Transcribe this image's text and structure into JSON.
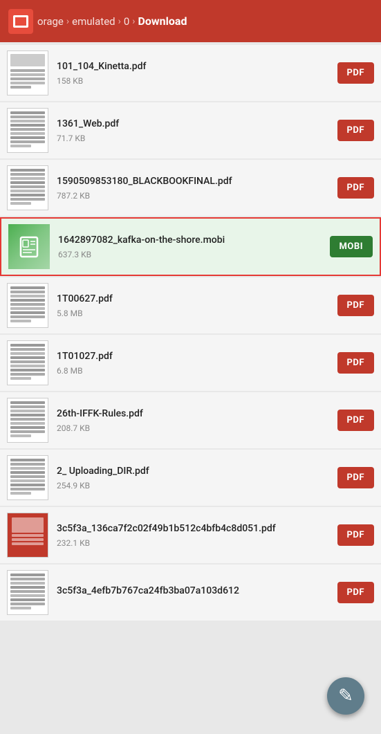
{
  "header": {
    "breadcrumbs": [
      {
        "label": "orage",
        "isCurrent": false
      },
      {
        "sep": "›"
      },
      {
        "label": "emulated",
        "isCurrent": false
      },
      {
        "sep": "›"
      },
      {
        "label": "0",
        "isCurrent": false
      },
      {
        "sep": "›"
      },
      {
        "label": "Download",
        "isCurrent": true
      }
    ],
    "logo_alt": "File Manager Logo"
  },
  "files": [
    {
      "id": 1,
      "name": "101_104_Kinetta.pdf",
      "size": "158 KB",
      "type": "PDF",
      "selected": false,
      "thumb_type": "image_pdf"
    },
    {
      "id": 2,
      "name": "1361_Web.pdf",
      "size": "71.7 KB",
      "type": "PDF",
      "selected": false,
      "thumb_type": "text_pdf"
    },
    {
      "id": 3,
      "name": "1590509853180_BLACKBOOKFINAL.pdf",
      "size": "787.2 KB",
      "type": "PDF",
      "selected": false,
      "thumb_type": "text_pdf2"
    },
    {
      "id": 4,
      "name": "1642897082_kafka-on-the-shore.mobi",
      "size": "637.3 KB",
      "type": "MOBI",
      "selected": true,
      "thumb_type": "mobi"
    },
    {
      "id": 5,
      "name": "1T00627.pdf",
      "size": "5.8 MB",
      "type": "PDF",
      "selected": false,
      "thumb_type": "text_pdf"
    },
    {
      "id": 6,
      "name": "1T01027.pdf",
      "size": "6.8 MB",
      "type": "PDF",
      "selected": false,
      "thumb_type": "text_pdf"
    },
    {
      "id": 7,
      "name": "26th-IFFK-Rules.pdf",
      "size": "208.7 KB",
      "type": "PDF",
      "selected": false,
      "thumb_type": "text_pdf3"
    },
    {
      "id": 8,
      "name": "2_ Uploading_DIR.pdf",
      "size": "254.9 KB",
      "type": "PDF",
      "selected": false,
      "thumb_type": "text_pdf"
    },
    {
      "id": 9,
      "name": "3c5f3a_136ca7f2c02f49b1b512c4bfb4c8d051.pdf",
      "size": "232.1 KB",
      "type": "PDF",
      "selected": false,
      "thumb_type": "cover_pdf"
    },
    {
      "id": 10,
      "name": "3c5f3a_4efb7b767ca24fb3ba07a103d612",
      "size": "",
      "type": "PDF",
      "selected": false,
      "thumb_type": "text_pdf"
    }
  ],
  "fab": {
    "icon": "✎",
    "label": "Edit"
  }
}
